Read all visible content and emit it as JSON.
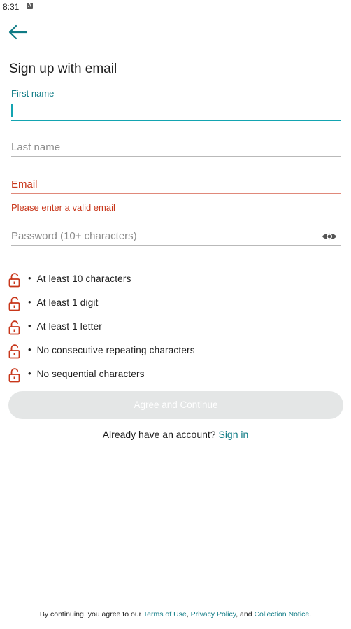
{
  "status_bar": {
    "time": "8:31",
    "notification_icon": "A"
  },
  "header": {
    "back_icon": "arrow-left-icon",
    "title": "Sign up with email"
  },
  "form": {
    "first_name": {
      "label": "First name",
      "value": ""
    },
    "last_name": {
      "placeholder": "Last name",
      "value": ""
    },
    "email": {
      "label": "Email",
      "value": "",
      "error": "Please enter a valid email"
    },
    "password": {
      "placeholder": "Password (10+ characters)",
      "value": "",
      "toggle_icon": "eye-icon"
    }
  },
  "requirements": [
    {
      "text": "At least 10 characters",
      "icon": "lock-icon",
      "bullet": "•"
    },
    {
      "text": "At least 1 digit",
      "icon": "lock-icon",
      "bullet": "•"
    },
    {
      "text": "At least 1 letter",
      "icon": "lock-icon",
      "bullet": "•"
    },
    {
      "text": "No consecutive repeating characters",
      "icon": "lock-icon",
      "bullet": "•"
    },
    {
      "text": "No sequential characters",
      "icon": "lock-icon",
      "bullet": "•"
    }
  ],
  "actions": {
    "agree_label": "Agree and Continue"
  },
  "signin": {
    "prompt": "Already have an account?",
    "link": "Sign in"
  },
  "legal": {
    "prefix": "By continuing, you agree to our",
    "terms": "Terms of Use",
    "sep1": ",",
    "privacy": "Privacy Policy",
    "sep2": ", and",
    "collection": "Collection Notice",
    "end": "."
  },
  "colors": {
    "accent": "#0f7b85",
    "focus": "#13a4b1",
    "error": "#c8361a",
    "disabled_button": "#e4e6e6"
  }
}
